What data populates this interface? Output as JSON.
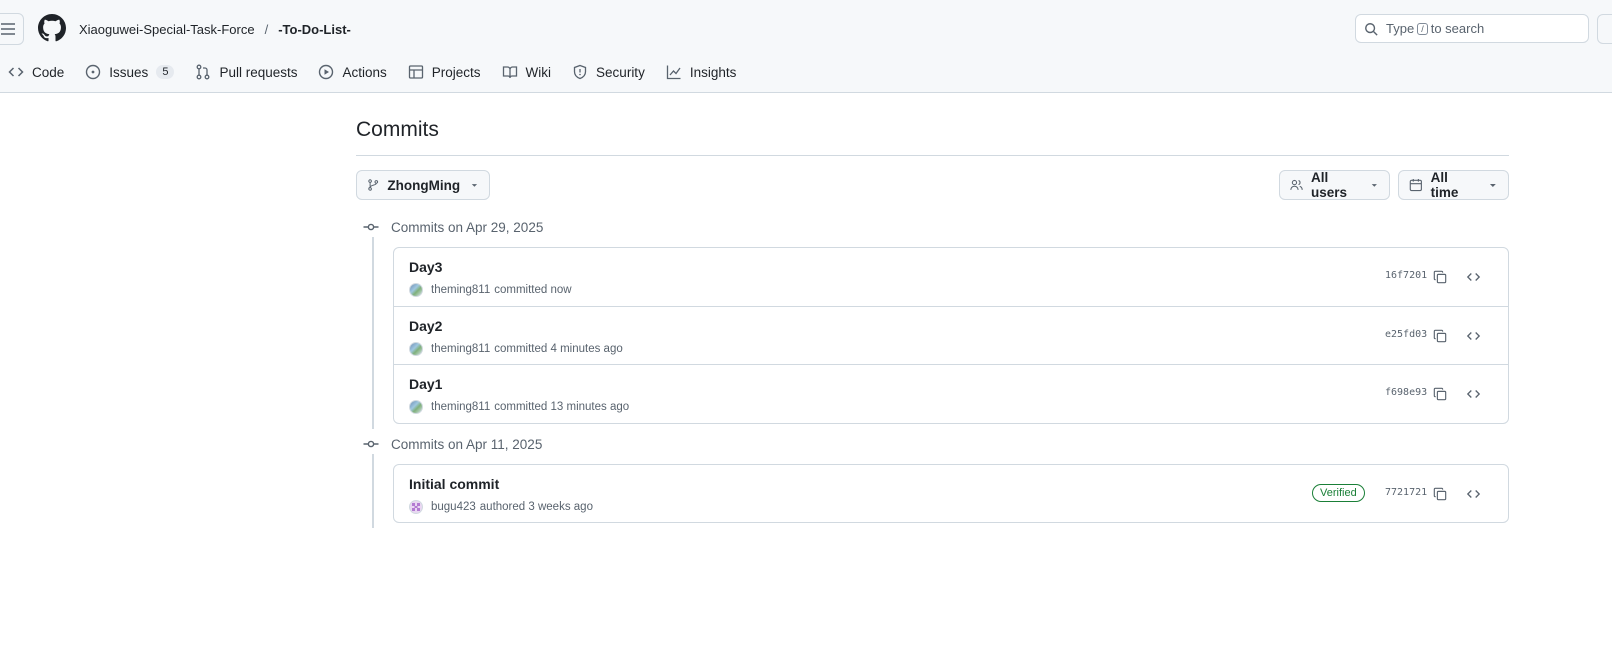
{
  "header": {
    "owner": "Xiaoguwei-Special-Task-Force",
    "separator": "/",
    "repo": "-To-Do-List-",
    "search": {
      "prefix": "Type",
      "key": "/",
      "suffix": "to search"
    }
  },
  "tabs": [
    {
      "label": "Code",
      "icon": "code-icon"
    },
    {
      "label": "Issues",
      "icon": "issue-opened-icon",
      "count": "5"
    },
    {
      "label": "Pull requests",
      "icon": "git-pull-request-icon"
    },
    {
      "label": "Actions",
      "icon": "play-icon"
    },
    {
      "label": "Projects",
      "icon": "table-icon"
    },
    {
      "label": "Wiki",
      "icon": "book-icon"
    },
    {
      "label": "Security",
      "icon": "shield-icon"
    },
    {
      "label": "Insights",
      "icon": "graph-icon"
    }
  ],
  "page": {
    "title": "Commits",
    "branch": "ZhongMing",
    "users_filter": "All users",
    "time_filter": "All time"
  },
  "groups": [
    {
      "heading": "Commits on Apr 29, 2025",
      "commits": [
        {
          "message": "Day3",
          "author": "theming811",
          "action": "committed",
          "when": "now",
          "sha": "16f7201",
          "verified": false
        },
        {
          "message": "Day2",
          "author": "theming811",
          "action": "committed",
          "when": "4 minutes ago",
          "sha": "e25fd03",
          "verified": false
        },
        {
          "message": "Day1",
          "author": "theming811",
          "action": "committed",
          "when": "13 minutes ago",
          "sha": "f698e93",
          "verified": false
        }
      ]
    },
    {
      "heading": "Commits on Apr 11, 2025",
      "commits": [
        {
          "message": "Initial commit",
          "author": "bugu423",
          "action": "authored",
          "when": "3 weeks ago",
          "sha": "7721721",
          "verified": true,
          "badge": "Verified"
        }
      ]
    }
  ],
  "colors": {
    "header_bg": "#f6f8fa",
    "border": "#d1d9e0",
    "text": "#1f2328",
    "muted": "#59636e",
    "verified_green": "#1a7f37"
  }
}
